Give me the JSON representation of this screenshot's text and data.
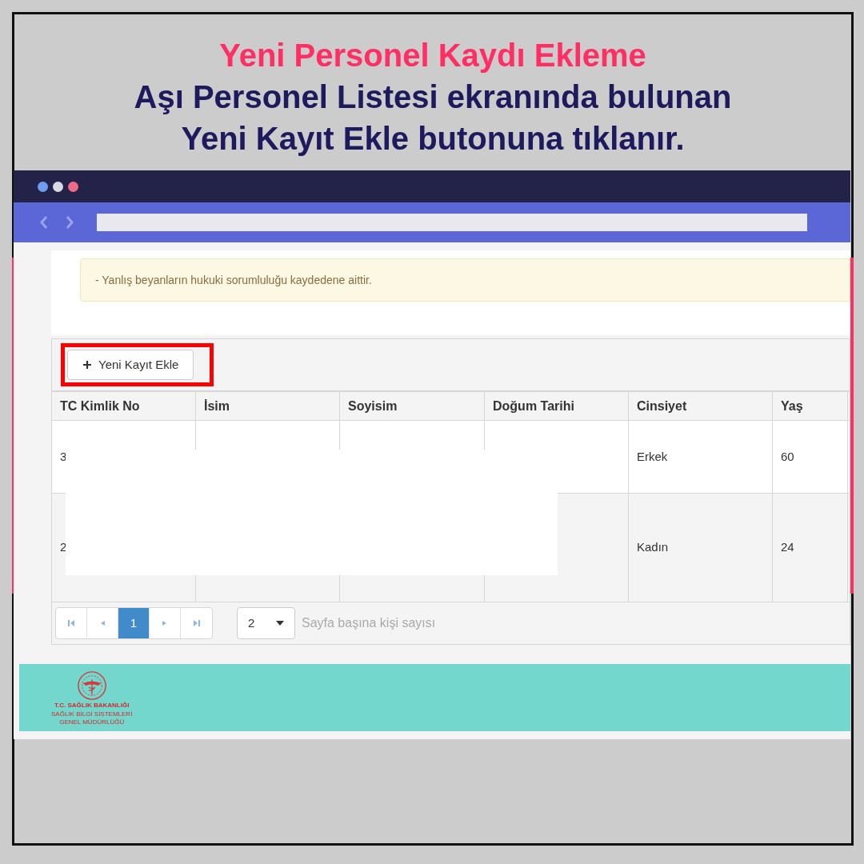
{
  "heading": {
    "title": "Yeni Personel Kaydı Ekleme",
    "lines": [
      "Aşı Personel Listesi ekranında bulunan",
      "**Yeni Kayıt Ekle** butonuna tıklanır."
    ]
  },
  "notice": "- Yanlış beyanların hukuki sorumluluğu kaydedene aittir.",
  "toolbar": {
    "button": "Yeni Kayıt Ekle",
    "highlighted": true
  },
  "table": {
    "columns": [
      "TC Kimlik No",
      "İsim",
      "Soyisim",
      "Doğum Tarihi",
      "Cinsiyet",
      "Yaş"
    ],
    "rows": [
      [
        "3",
        "",
        "",
        "",
        "Erkek",
        "60"
      ],
      [
        "2",
        "",
        "",
        "",
        "Kadın",
        "24"
      ]
    ]
  },
  "pagination": {
    "pages": [
      {
        "label": "1",
        "selected": true
      }
    ],
    "page_size": "2",
    "page_size_label": "Sayfa başına kişi sayısı"
  },
  "footer": {
    "logo_lines": [
      "T.C. SAĞLIK BAKANLIĞI",
      "SAĞLIK BİLGİ SİSTEMLERİ",
      "GENEL MÜDÜRLÜĞÜ"
    ]
  }
}
